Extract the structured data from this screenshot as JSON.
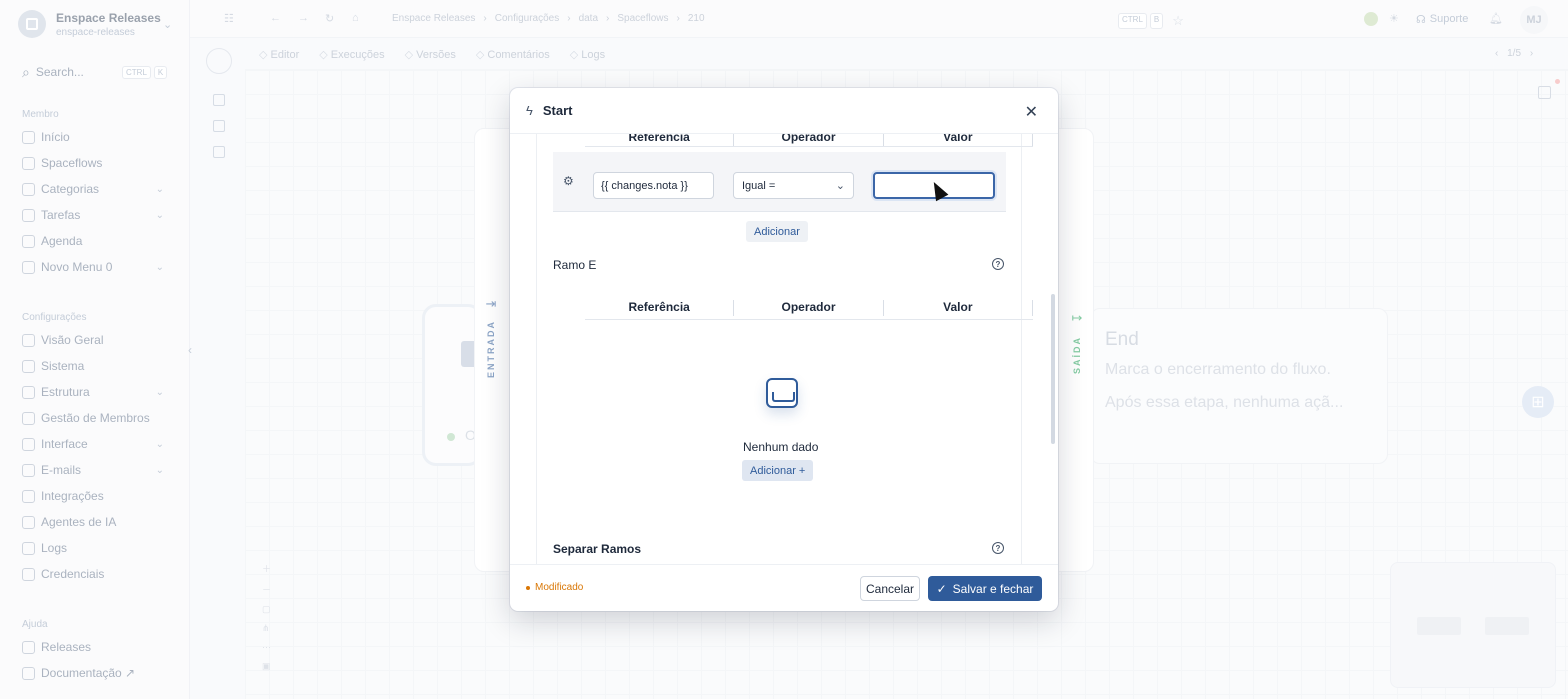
{
  "workspace": {
    "name": "Enspace Releases",
    "slug": "enspace-releases"
  },
  "search": {
    "label": "Search...",
    "kbd1": "CTRL",
    "kbd2": "K"
  },
  "sidebar": {
    "section_member": "Membro",
    "member_items": [
      {
        "label": "Início",
        "icon": "home-icon"
      },
      {
        "label": "Spaceflows",
        "icon": "flow-icon"
      },
      {
        "label": "Categorias",
        "icon": "grid-icon"
      },
      {
        "label": "Tarefas",
        "icon": "file-icon"
      },
      {
        "label": "Agenda",
        "icon": "calendar-icon"
      },
      {
        "label": "Novo Menu 0",
        "icon": "menu-icon"
      }
    ],
    "section_config": "Configurações",
    "config_items": [
      {
        "label": "Visão Geral",
        "icon": "dashboard-icon"
      },
      {
        "label": "Sistema",
        "icon": "gear-icon"
      },
      {
        "label": "Estrutura",
        "icon": "database-icon"
      },
      {
        "label": "Gestão de Membros",
        "icon": "users-icon"
      },
      {
        "label": "Interface",
        "icon": "palette-icon"
      },
      {
        "label": "E-mails",
        "icon": "mail-icon"
      },
      {
        "label": "Integrações",
        "icon": "plug-icon"
      },
      {
        "label": "Agentes de IA",
        "icon": "bot-icon"
      },
      {
        "label": "Logs",
        "icon": "activity-icon"
      },
      {
        "label": "Credenciais",
        "icon": "key-icon"
      }
    ],
    "section_help": "Ajuda",
    "help_items": [
      {
        "label": "Releases",
        "icon": "doc-icon"
      },
      {
        "label": "Documentação ↗",
        "icon": "book-icon"
      }
    ]
  },
  "breadcrumb": [
    "Enspace Releases",
    "Configurações",
    "data",
    "Spaceflows",
    "210"
  ],
  "topbar": {
    "kbd1": "CTRL",
    "kbd2": "B",
    "support": "Suporte",
    "avatar": "MJ"
  },
  "subtabs": [
    "Editor",
    "Execuções",
    "Versões",
    "Comentários",
    "Logs"
  ],
  "pager": "1/5",
  "canvas": {
    "end_title": "End",
    "end_desc_1": "Marca o encerramento do fluxo.",
    "end_desc_2": "Após essa etapa, nenhuma açã...",
    "start_label": "O"
  },
  "side": {
    "entrada": "ENTRADA",
    "saida": "SAÍDA"
  },
  "modal": {
    "title": "Start",
    "columns": [
      "Referência",
      "Operador",
      "Valor"
    ],
    "row": {
      "reference": "{{ changes.nota }}",
      "operator": "Igual =",
      "value": ""
    },
    "add_label": "Adicionar",
    "branch_title": "Ramo E",
    "empty_text": "Nenhum dado",
    "add_plus_label": "Adicionar +",
    "separate_title": "Separar Ramos",
    "status": "Modificado",
    "cancel": "Cancelar",
    "save": "Salvar e fechar"
  },
  "colors": {
    "primary": "#2f5b9a",
    "modified": "#d97706"
  }
}
